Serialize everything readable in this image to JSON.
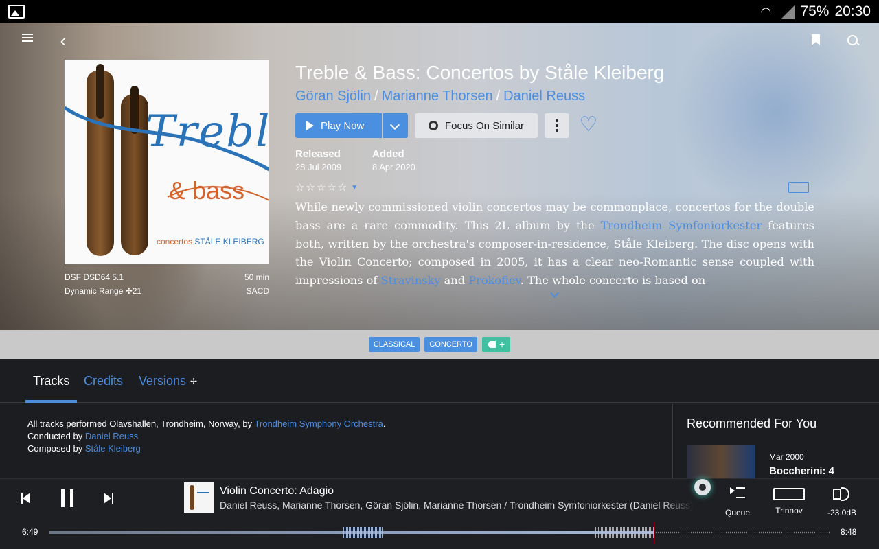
{
  "status_bar": {
    "battery": "75%",
    "time": "20:30"
  },
  "album": {
    "title": "Treble & Bass: Concertos by Ståle Kleiberg",
    "artists": [
      "Göran Sjölin",
      "Marianne Thorsen",
      "Daniel Reuss"
    ],
    "separator": "/",
    "cover": {
      "title": "Treble",
      "sub": "& bass",
      "credit_a": "concertos",
      "credit_b": "STÅLE KLEIBERG"
    },
    "format": "DSF DSD64 5.1",
    "duration": "50 min",
    "dynamic_range": "Dynamic Range  ✢21",
    "source": "SACD",
    "released_label": "Released",
    "released": "28 Jul 2009",
    "added_label": "Added",
    "added": "8 Apr 2020",
    "stars": "☆☆☆☆☆",
    "star_dropdown": "▼"
  },
  "actions": {
    "play_now": "Play Now",
    "focus_on_similar": "Focus On Similar",
    "heart": "♡"
  },
  "review": {
    "p1": "While newly commissioned violin concertos may be commonplace, concertos for the double bass are a rare commodity. This 2L album by the ",
    "link1": "Trondheim Symfoniorkester",
    "p2": " features both, written by the orchestra's composer-in-residence, Ståle Kleiberg. The disc opens with the Violin Concerto; composed in 2005, it has a clear neo-Romantic sense coupled with impressions of ",
    "link2": "Stravinsky",
    "p3": " and ",
    "link3": "Prokofiev",
    "p4": ". The whole concerto is based on"
  },
  "tags": [
    "CLASSICAL",
    "CONCERTO"
  ],
  "tag_add": "+",
  "tabs": {
    "tracks": "Tracks",
    "credits": "Credits",
    "versions": "Versions",
    "versions_icon": "✢"
  },
  "notes": {
    "line1_prefix": "All tracks performed Olavshallen, Trondheim, Norway, by ",
    "line1_link": "Trondheim Symphony Orchestra",
    "line1_suffix": ".",
    "line2_prefix": "Conducted by ",
    "line2_link": "Daniel Reuss",
    "line3_prefix": "Composed by ",
    "line3_link": "Ståle Kleiberg"
  },
  "recommended": {
    "title": "Recommended For You",
    "date": "Mar 2000",
    "name": "Boccherini: 4"
  },
  "player": {
    "track": "Violin Concerto: Adagio",
    "artists": "Daniel Reuss, Marianne Thorsen, Göran Sjölin, Marianne Thorsen / Trondheim Symfoniorkester (Daniel Reuss)",
    "queue": "Queue",
    "zone": "Trinnov",
    "volume": "-23.0dB",
    "elapsed": "6:49",
    "total": "8:48",
    "progress": 0.775
  },
  "colors": {
    "accent": "#4a8fe0",
    "tag_add": "#41bfa1",
    "seek_head": "#d8324a"
  }
}
